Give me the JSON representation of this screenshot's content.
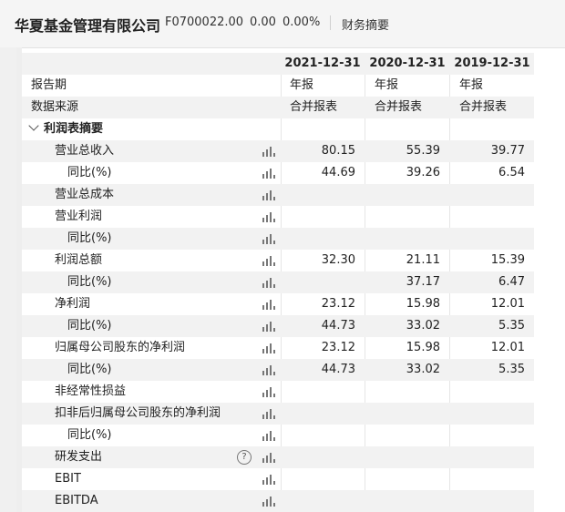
{
  "header": {
    "title": "华夏基金管理有限公司",
    "code": "F0700022.00",
    "price": "0.00",
    "change_pct": "0.00%",
    "tab": "财务摘要"
  },
  "table": {
    "years": [
      "2021-12-31",
      "2020-12-31",
      "2019-12-31"
    ],
    "report_period_label": "报告期",
    "report_period_values": [
      "年报",
      "年报",
      "年报"
    ],
    "data_source_label": "数据来源",
    "data_source_values": [
      "合并报表",
      "合并报表",
      "合并报表"
    ],
    "section_label": "利润表摘要",
    "rows": [
      {
        "label": "营业总收入",
        "values": [
          "80.15",
          "55.39",
          "39.77"
        ]
      },
      {
        "label": "同比(%)",
        "values": [
          "44.69",
          "39.26",
          "6.54"
        ]
      },
      {
        "label": "营业总成本",
        "values": [
          "",
          "",
          ""
        ]
      },
      {
        "label": "营业利润",
        "values": [
          "",
          "",
          ""
        ]
      },
      {
        "label": "同比(%)",
        "values": [
          "",
          "",
          ""
        ]
      },
      {
        "label": "利润总额",
        "values": [
          "32.30",
          "21.11",
          "15.39"
        ]
      },
      {
        "label": "同比(%)",
        "values": [
          "",
          "37.17",
          "6.47"
        ]
      },
      {
        "label": "净利润",
        "values": [
          "23.12",
          "15.98",
          "12.01"
        ]
      },
      {
        "label": "同比(%)",
        "values": [
          "44.73",
          "33.02",
          "5.35"
        ]
      },
      {
        "label": "归属母公司股东的净利润",
        "values": [
          "23.12",
          "15.98",
          "12.01"
        ]
      },
      {
        "label": "同比(%)",
        "values": [
          "44.73",
          "33.02",
          "5.35"
        ]
      },
      {
        "label": "非经常性损益",
        "values": [
          "",
          "",
          ""
        ]
      },
      {
        "label": "扣非后归属母公司股东的净利润",
        "values": [
          "",
          "",
          ""
        ]
      },
      {
        "label": "同比(%)",
        "values": [
          "",
          "",
          ""
        ]
      },
      {
        "label": "研发支出",
        "values": [
          "",
          "",
          ""
        ],
        "help": "?"
      },
      {
        "label": "EBIT",
        "values": [
          "",
          "",
          ""
        ]
      },
      {
        "label": "EBITDA",
        "values": [
          "",
          "",
          ""
        ]
      }
    ]
  },
  "icons": {
    "row_chart": "bar-chart-icon",
    "help": "help-icon",
    "collapse": "chevron-down-icon"
  },
  "colors": {
    "stripe": "#f2f2f2",
    "header_bg": "#f5f5f5",
    "text": "#222222"
  }
}
